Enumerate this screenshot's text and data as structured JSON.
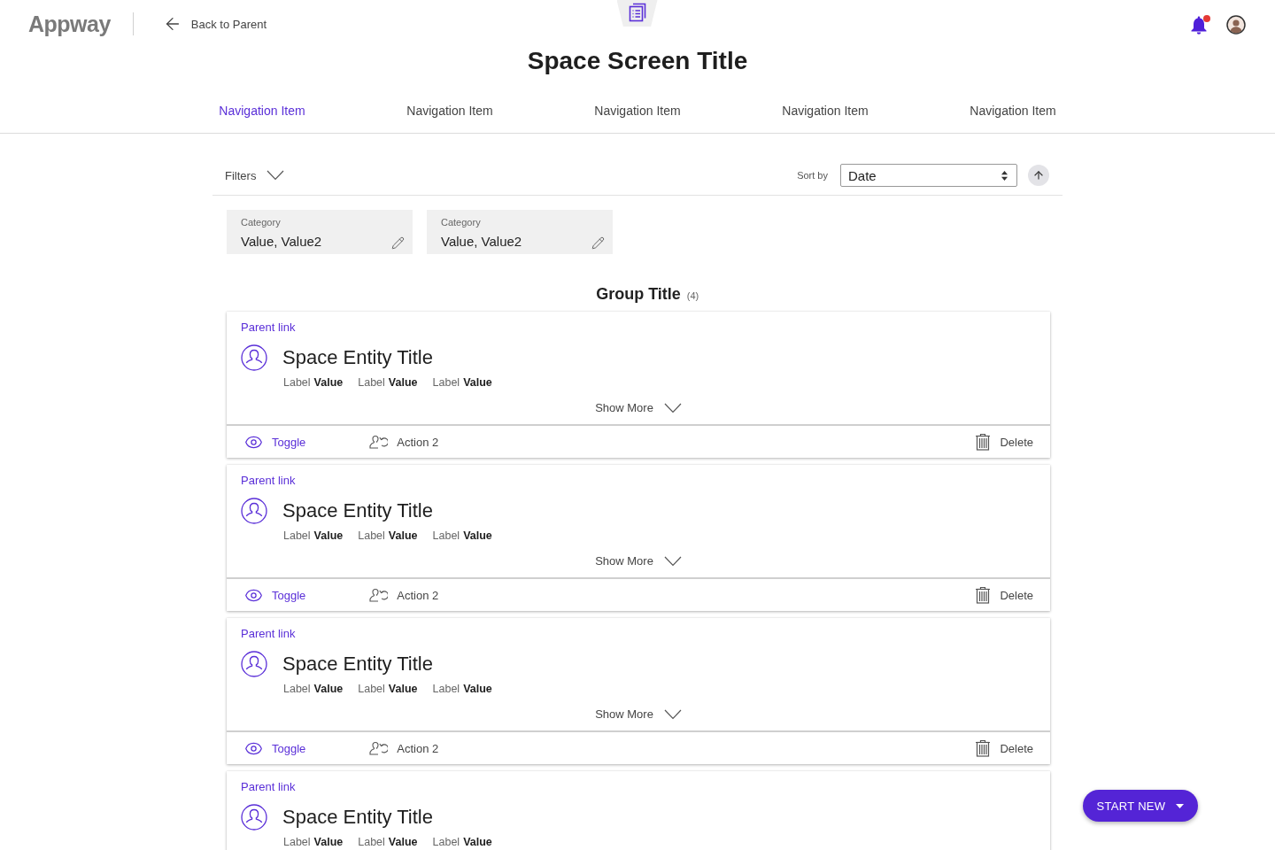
{
  "header": {
    "logo": "Appway",
    "back_link": "Back to Parent",
    "notifications_unread": true
  },
  "title": "Space Screen Title",
  "nav": [
    {
      "label": "Navigation Item",
      "selected": true
    },
    {
      "label": "Navigation Item",
      "selected": false
    },
    {
      "label": "Navigation Item",
      "selected": false
    },
    {
      "label": "Navigation Item",
      "selected": false
    },
    {
      "label": "Navigation Item",
      "selected": false
    }
  ],
  "toolbar": {
    "filters": "Filters",
    "sort_label": "Sort by",
    "sort_value": "Date",
    "sort_ascending": true
  },
  "filter_chips": [
    {
      "category": "Category",
      "value": "Value, Value2"
    },
    {
      "category": "Category",
      "value": "Value, Value2"
    }
  ],
  "group": {
    "title": "Group Title",
    "count": "(4)"
  },
  "cards": [
    {
      "parent_link": "Parent link",
      "title": "Space Entity Title",
      "fields": [
        {
          "label": "Label",
          "value": "Value"
        },
        {
          "label": "Label",
          "value": "Value"
        },
        {
          "label": "Label",
          "value": "Value"
        }
      ],
      "show_more": "Show More",
      "actions": [
        {
          "kind": "toggle",
          "label": "Toggle"
        },
        {
          "kind": "action",
          "label": "Action 2"
        },
        {
          "kind": "delete",
          "label": "Delete"
        }
      ]
    },
    {
      "parent_link": "Parent link",
      "title": "Space Entity Title",
      "fields": [
        {
          "label": "Label",
          "value": "Value"
        },
        {
          "label": "Label",
          "value": "Value"
        },
        {
          "label": "Label",
          "value": "Value"
        }
      ],
      "show_more": "Show More",
      "actions": [
        {
          "kind": "toggle",
          "label": "Toggle"
        },
        {
          "kind": "action",
          "label": "Action 2"
        },
        {
          "kind": "delete",
          "label": "Delete"
        }
      ]
    },
    {
      "parent_link": "Parent link",
      "title": "Space Entity Title",
      "fields": [
        {
          "label": "Label",
          "value": "Value"
        },
        {
          "label": "Label",
          "value": "Value"
        },
        {
          "label": "Label",
          "value": "Value"
        }
      ],
      "show_more": "Show More",
      "actions": [
        {
          "kind": "toggle",
          "label": "Toggle"
        },
        {
          "kind": "action",
          "label": "Action 2"
        },
        {
          "kind": "delete",
          "label": "Delete"
        }
      ]
    },
    {
      "parent_link": "Parent link",
      "title": "Space Entity Title",
      "fields": [
        {
          "label": "Label",
          "value": "Value"
        },
        {
          "label": "Label",
          "value": "Value"
        },
        {
          "label": "Label",
          "value": "Value"
        }
      ]
    }
  ],
  "fab": {
    "label": "START NEW"
  }
}
